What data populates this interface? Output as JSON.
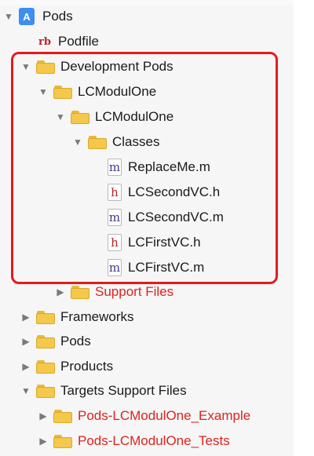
{
  "navigator": {
    "root": {
      "label": "Pods",
      "icon": "xcode-project-icon"
    },
    "items": [
      {
        "label": "Podfile",
        "icon": "ruby-file-icon",
        "badge": "rb"
      },
      {
        "label": "Development Pods",
        "icon": "folder-icon"
      },
      {
        "label": "LCModulOne",
        "icon": "folder-icon"
      },
      {
        "label": "LCModulOne",
        "icon": "folder-icon"
      },
      {
        "label": "Classes",
        "icon": "folder-icon"
      },
      {
        "label": "ReplaceMe.m",
        "icon": "m-file-icon",
        "badge": "m"
      },
      {
        "label": "LCSecondVC.h",
        "icon": "h-file-icon",
        "badge": "h"
      },
      {
        "label": "LCSecondVC.m",
        "icon": "m-file-icon",
        "badge": "m"
      },
      {
        "label": "LCFirstVC.h",
        "icon": "h-file-icon",
        "badge": "h"
      },
      {
        "label": "LCFirstVC.m",
        "icon": "m-file-icon",
        "badge": "m"
      },
      {
        "label": "Support Files",
        "icon": "folder-icon"
      },
      {
        "label": "Frameworks",
        "icon": "folder-icon"
      },
      {
        "label": "Pods",
        "icon": "folder-icon"
      },
      {
        "label": "Products",
        "icon": "folder-icon"
      },
      {
        "label": "Targets Support Files",
        "icon": "folder-icon"
      },
      {
        "label": "Pods-LCModulOne_Example",
        "icon": "folder-icon"
      },
      {
        "label": "Pods-LCModulOne_Tests",
        "icon": "folder-icon"
      }
    ]
  },
  "colors": {
    "missing_reference": "#e0211d",
    "highlight_border": "#e8191b"
  }
}
